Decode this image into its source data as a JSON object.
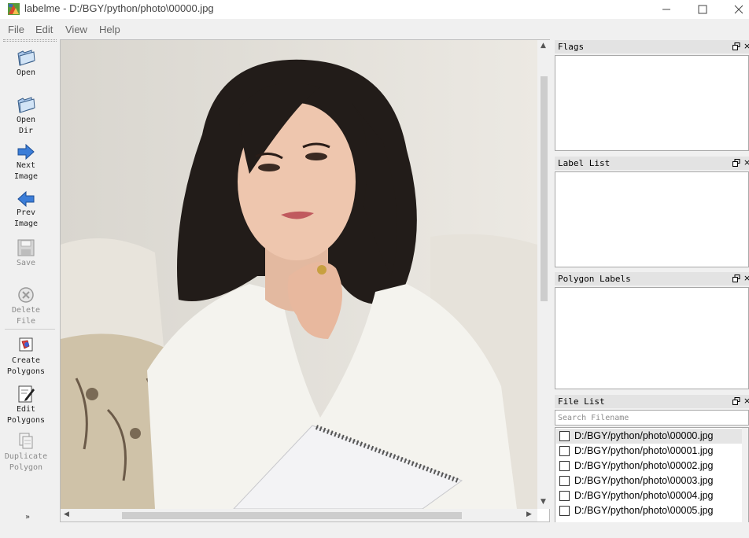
{
  "window": {
    "title": "labelme - D:/BGY/python/photo\\00000.jpg"
  },
  "menu": [
    "File",
    "Edit",
    "View",
    "Help"
  ],
  "toolbar": {
    "tools": [
      {
        "label": "Open",
        "icon": "folder-open-icon",
        "enabled": true
      },
      {
        "label": "Open\nDir",
        "icon": "folder-dir-icon",
        "enabled": true
      },
      {
        "label": "Next\nImage",
        "icon": "arrow-right-icon",
        "enabled": true
      },
      {
        "label": "Prev\nImage",
        "icon": "arrow-left-icon",
        "enabled": true
      },
      {
        "label": "Save",
        "icon": "floppy-icon",
        "enabled": false
      },
      {
        "label": "Delete\nFile",
        "icon": "delete-circle-icon",
        "enabled": false
      },
      {
        "label": "Create\nPolygons",
        "icon": "polygon-create-icon",
        "enabled": true
      },
      {
        "label": "Edit\nPolygons",
        "icon": "polygon-edit-icon",
        "enabled": true
      },
      {
        "label": "Duplicate\nPolygon",
        "icon": "duplicate-icon",
        "enabled": false
      }
    ],
    "more": "»"
  },
  "docks": {
    "flags": {
      "title": "Flags"
    },
    "label_list": {
      "title": "Label List"
    },
    "polygon_labels": {
      "title": "Polygon Labels"
    },
    "file_list": {
      "title": "File List",
      "search_placeholder": "Search Filename",
      "files": [
        "D:/BGY/python/photo\\00000.jpg",
        "D:/BGY/python/photo\\00001.jpg",
        "D:/BGY/python/photo\\00002.jpg",
        "D:/BGY/python/photo\\00003.jpg",
        "D:/BGY/python/photo\\00004.jpg",
        "D:/BGY/python/photo\\00005.jpg"
      ],
      "selected_index": 0
    }
  },
  "colors": {
    "accent_blue": "#3b7dd8",
    "panel_bg": "#f0f0f0"
  }
}
